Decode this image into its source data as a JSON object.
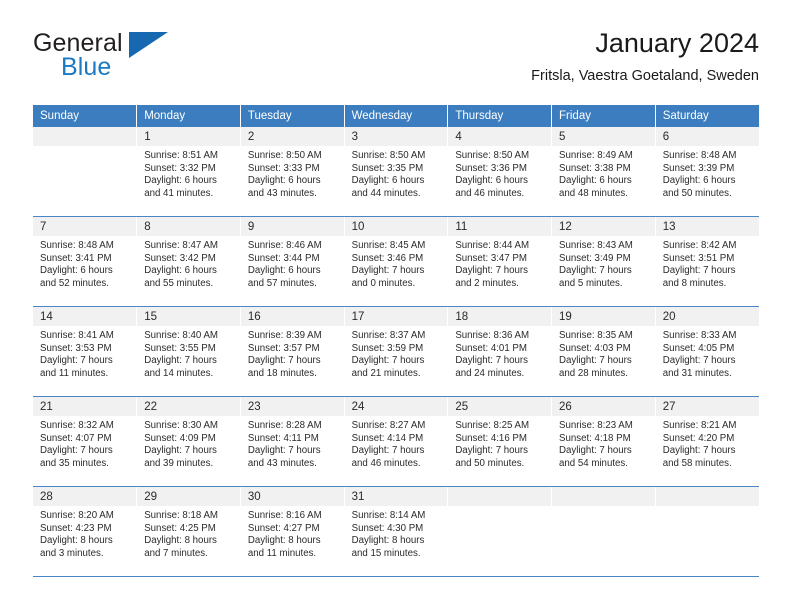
{
  "brand": {
    "name_part1": "General",
    "name_part2": "Blue",
    "triangle_color": "#1668b0"
  },
  "header": {
    "title": "January 2024",
    "subtitle": "Fritsla, Vaestra Goetaland, Sweden",
    "accent_color": "#3b7dbf",
    "daynum_band_color": "#f1f1f1"
  },
  "calendar": {
    "weekday_headers": [
      "Sunday",
      "Monday",
      "Tuesday",
      "Wednesday",
      "Thursday",
      "Friday",
      "Saturday"
    ],
    "weeks": [
      [
        {
          "day": "",
          "sunrise": "",
          "sunset": "",
          "daylight_line1": "",
          "daylight_line2": ""
        },
        {
          "day": "1",
          "sunrise": "Sunrise: 8:51 AM",
          "sunset": "Sunset: 3:32 PM",
          "daylight_line1": "Daylight: 6 hours",
          "daylight_line2": "and 41 minutes."
        },
        {
          "day": "2",
          "sunrise": "Sunrise: 8:50 AM",
          "sunset": "Sunset: 3:33 PM",
          "daylight_line1": "Daylight: 6 hours",
          "daylight_line2": "and 43 minutes."
        },
        {
          "day": "3",
          "sunrise": "Sunrise: 8:50 AM",
          "sunset": "Sunset: 3:35 PM",
          "daylight_line1": "Daylight: 6 hours",
          "daylight_line2": "and 44 minutes."
        },
        {
          "day": "4",
          "sunrise": "Sunrise: 8:50 AM",
          "sunset": "Sunset: 3:36 PM",
          "daylight_line1": "Daylight: 6 hours",
          "daylight_line2": "and 46 minutes."
        },
        {
          "day": "5",
          "sunrise": "Sunrise: 8:49 AM",
          "sunset": "Sunset: 3:38 PM",
          "daylight_line1": "Daylight: 6 hours",
          "daylight_line2": "and 48 minutes."
        },
        {
          "day": "6",
          "sunrise": "Sunrise: 8:48 AM",
          "sunset": "Sunset: 3:39 PM",
          "daylight_line1": "Daylight: 6 hours",
          "daylight_line2": "and 50 minutes."
        }
      ],
      [
        {
          "day": "7",
          "sunrise": "Sunrise: 8:48 AM",
          "sunset": "Sunset: 3:41 PM",
          "daylight_line1": "Daylight: 6 hours",
          "daylight_line2": "and 52 minutes."
        },
        {
          "day": "8",
          "sunrise": "Sunrise: 8:47 AM",
          "sunset": "Sunset: 3:42 PM",
          "daylight_line1": "Daylight: 6 hours",
          "daylight_line2": "and 55 minutes."
        },
        {
          "day": "9",
          "sunrise": "Sunrise: 8:46 AM",
          "sunset": "Sunset: 3:44 PM",
          "daylight_line1": "Daylight: 6 hours",
          "daylight_line2": "and 57 minutes."
        },
        {
          "day": "10",
          "sunrise": "Sunrise: 8:45 AM",
          "sunset": "Sunset: 3:46 PM",
          "daylight_line1": "Daylight: 7 hours",
          "daylight_line2": "and 0 minutes."
        },
        {
          "day": "11",
          "sunrise": "Sunrise: 8:44 AM",
          "sunset": "Sunset: 3:47 PM",
          "daylight_line1": "Daylight: 7 hours",
          "daylight_line2": "and 2 minutes."
        },
        {
          "day": "12",
          "sunrise": "Sunrise: 8:43 AM",
          "sunset": "Sunset: 3:49 PM",
          "daylight_line1": "Daylight: 7 hours",
          "daylight_line2": "and 5 minutes."
        },
        {
          "day": "13",
          "sunrise": "Sunrise: 8:42 AM",
          "sunset": "Sunset: 3:51 PM",
          "daylight_line1": "Daylight: 7 hours",
          "daylight_line2": "and 8 minutes."
        }
      ],
      [
        {
          "day": "14",
          "sunrise": "Sunrise: 8:41 AM",
          "sunset": "Sunset: 3:53 PM",
          "daylight_line1": "Daylight: 7 hours",
          "daylight_line2": "and 11 minutes."
        },
        {
          "day": "15",
          "sunrise": "Sunrise: 8:40 AM",
          "sunset": "Sunset: 3:55 PM",
          "daylight_line1": "Daylight: 7 hours",
          "daylight_line2": "and 14 minutes."
        },
        {
          "day": "16",
          "sunrise": "Sunrise: 8:39 AM",
          "sunset": "Sunset: 3:57 PM",
          "daylight_line1": "Daylight: 7 hours",
          "daylight_line2": "and 18 minutes."
        },
        {
          "day": "17",
          "sunrise": "Sunrise: 8:37 AM",
          "sunset": "Sunset: 3:59 PM",
          "daylight_line1": "Daylight: 7 hours",
          "daylight_line2": "and 21 minutes."
        },
        {
          "day": "18",
          "sunrise": "Sunrise: 8:36 AM",
          "sunset": "Sunset: 4:01 PM",
          "daylight_line1": "Daylight: 7 hours",
          "daylight_line2": "and 24 minutes."
        },
        {
          "day": "19",
          "sunrise": "Sunrise: 8:35 AM",
          "sunset": "Sunset: 4:03 PM",
          "daylight_line1": "Daylight: 7 hours",
          "daylight_line2": "and 28 minutes."
        },
        {
          "day": "20",
          "sunrise": "Sunrise: 8:33 AM",
          "sunset": "Sunset: 4:05 PM",
          "daylight_line1": "Daylight: 7 hours",
          "daylight_line2": "and 31 minutes."
        }
      ],
      [
        {
          "day": "21",
          "sunrise": "Sunrise: 8:32 AM",
          "sunset": "Sunset: 4:07 PM",
          "daylight_line1": "Daylight: 7 hours",
          "daylight_line2": "and 35 minutes."
        },
        {
          "day": "22",
          "sunrise": "Sunrise: 8:30 AM",
          "sunset": "Sunset: 4:09 PM",
          "daylight_line1": "Daylight: 7 hours",
          "daylight_line2": "and 39 minutes."
        },
        {
          "day": "23",
          "sunrise": "Sunrise: 8:28 AM",
          "sunset": "Sunset: 4:11 PM",
          "daylight_line1": "Daylight: 7 hours",
          "daylight_line2": "and 43 minutes."
        },
        {
          "day": "24",
          "sunrise": "Sunrise: 8:27 AM",
          "sunset": "Sunset: 4:14 PM",
          "daylight_line1": "Daylight: 7 hours",
          "daylight_line2": "and 46 minutes."
        },
        {
          "day": "25",
          "sunrise": "Sunrise: 8:25 AM",
          "sunset": "Sunset: 4:16 PM",
          "daylight_line1": "Daylight: 7 hours",
          "daylight_line2": "and 50 minutes."
        },
        {
          "day": "26",
          "sunrise": "Sunrise: 8:23 AM",
          "sunset": "Sunset: 4:18 PM",
          "daylight_line1": "Daylight: 7 hours",
          "daylight_line2": "and 54 minutes."
        },
        {
          "day": "27",
          "sunrise": "Sunrise: 8:21 AM",
          "sunset": "Sunset: 4:20 PM",
          "daylight_line1": "Daylight: 7 hours",
          "daylight_line2": "and 58 minutes."
        }
      ],
      [
        {
          "day": "28",
          "sunrise": "Sunrise: 8:20 AM",
          "sunset": "Sunset: 4:23 PM",
          "daylight_line1": "Daylight: 8 hours",
          "daylight_line2": "and 3 minutes."
        },
        {
          "day": "29",
          "sunrise": "Sunrise: 8:18 AM",
          "sunset": "Sunset: 4:25 PM",
          "daylight_line1": "Daylight: 8 hours",
          "daylight_line2": "and 7 minutes."
        },
        {
          "day": "30",
          "sunrise": "Sunrise: 8:16 AM",
          "sunset": "Sunset: 4:27 PM",
          "daylight_line1": "Daylight: 8 hours",
          "daylight_line2": "and 11 minutes."
        },
        {
          "day": "31",
          "sunrise": "Sunrise: 8:14 AM",
          "sunset": "Sunset: 4:30 PM",
          "daylight_line1": "Daylight: 8 hours",
          "daylight_line2": "and 15 minutes."
        },
        {
          "day": "",
          "sunrise": "",
          "sunset": "",
          "daylight_line1": "",
          "daylight_line2": ""
        },
        {
          "day": "",
          "sunrise": "",
          "sunset": "",
          "daylight_line1": "",
          "daylight_line2": ""
        },
        {
          "day": "",
          "sunrise": "",
          "sunset": "",
          "daylight_line1": "",
          "daylight_line2": ""
        }
      ]
    ]
  }
}
